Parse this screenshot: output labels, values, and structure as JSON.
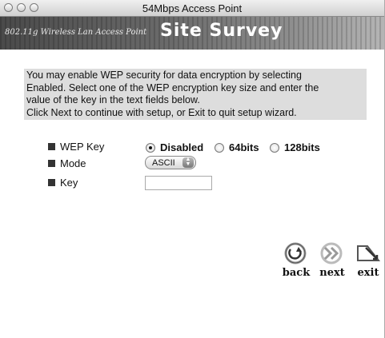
{
  "window": {
    "title": "54Mbps Access Point"
  },
  "banner": {
    "subtitle": "802.11g Wireless Lan Access Point",
    "title": "Site Survey"
  },
  "info": {
    "lines": [
      "You may enable WEP security for data encryption by selecting",
      "Enabled. Select one of the WEP encryption key size and enter the",
      "value of the key in the text fields below.",
      "Click Next to continue with setup, or Exit to quit setup wizard."
    ]
  },
  "form": {
    "wep_label": "WEP Key",
    "wep_options": [
      "Disabled",
      "64bits",
      "128bits"
    ],
    "wep_selected": "Disabled",
    "mode_label": "Mode",
    "mode_value": "ASCII",
    "key_label": "Key",
    "key_value": ""
  },
  "nav": {
    "back": "back",
    "next": "next",
    "exit": "exit"
  }
}
